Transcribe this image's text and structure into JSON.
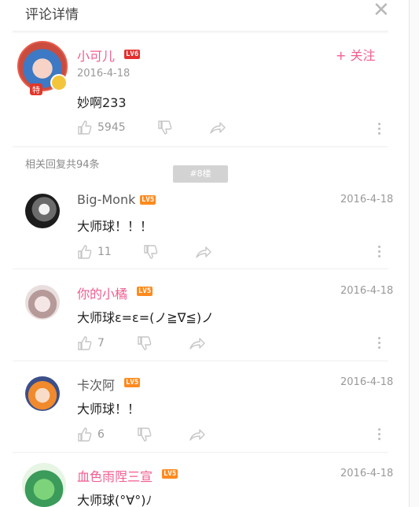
{
  "header": {
    "title": "评论详情",
    "close_symbol": "✕"
  },
  "main_comment": {
    "username": "小可儿",
    "level": "LV6",
    "date": "2016-4-18",
    "content": "妙啊233",
    "likes": "5945",
    "follow_label": "+ 关注",
    "avatar_tag": "特"
  },
  "replies_header": {
    "label": "相关回复共94条",
    "floor_tag": "#8楼"
  },
  "replies": [
    {
      "username": "Big-Monk",
      "level": "LV5",
      "date": "2016-4-18",
      "content": "大师球！！！",
      "likes": "11"
    },
    {
      "username": "你的小橘",
      "level": "LV5",
      "date": "2016-4-18",
      "content": "大师球ε=ε=(ノ≧∇≦)ノ",
      "likes": "7"
    },
    {
      "username": "卡次阿",
      "level": "LV5",
      "date": "2016-4-18",
      "content": "大师球！！",
      "likes": "6"
    },
    {
      "username": "血色雨陧三宣",
      "level": "LV5",
      "date": "2016-4-18",
      "content": "大师球(°∀°)ﾉ"
    }
  ],
  "colors": {
    "accent_pink": "#f25d8e",
    "level6": "#e52f2f",
    "level5": "#ff8a1e"
  }
}
